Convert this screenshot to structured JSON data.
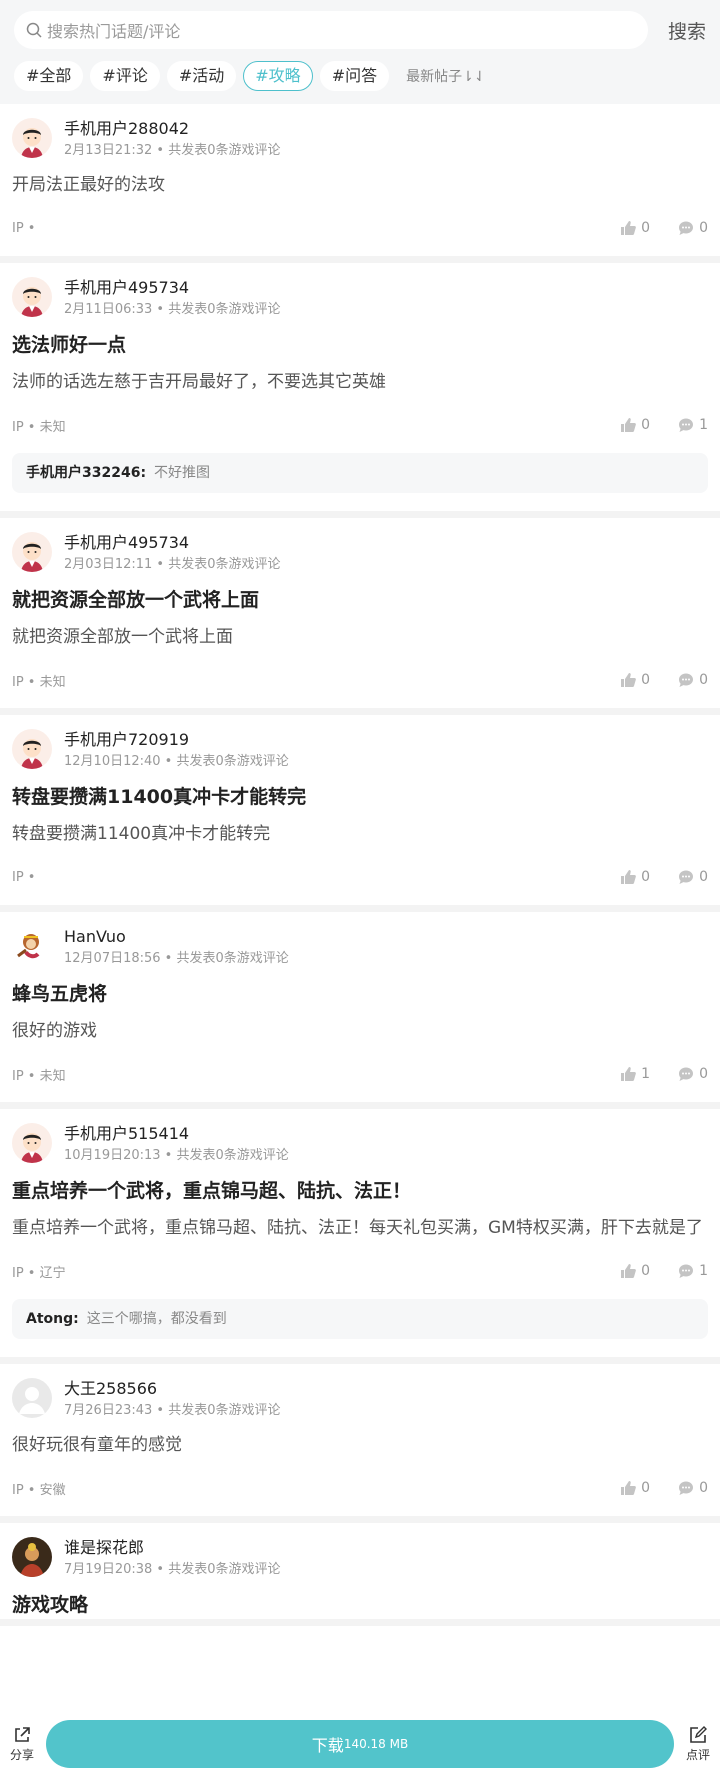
{
  "search": {
    "placeholder": "搜索热门话题/评论",
    "button": "搜索"
  },
  "tags": [
    "#全部",
    "#评论",
    "#活动",
    "#攻略",
    "#问答"
  ],
  "active_tag": "#攻略",
  "sort_label": "最新帖子⇂⇃",
  "posts": [
    {
      "user": "手机用户288042",
      "meta": "2月13日21:32 • 共发表0条游戏评论",
      "title": "",
      "body": "开局法正最好的法攻",
      "ip": "IP •",
      "likes": "0",
      "comments": "0",
      "reply": null,
      "avatar": "boy"
    },
    {
      "user": "手机用户495734",
      "meta": "2月11日06:33 • 共发表0条游戏评论",
      "title": "选法师好一点",
      "body": "法师的话选左慈于吉开局最好了，不要选其它英雄",
      "ip": "IP • 未知",
      "likes": "0",
      "comments": "1",
      "reply": {
        "user": "手机用户332246:",
        "text": "不好推图"
      },
      "avatar": "boy"
    },
    {
      "user": "手机用户495734",
      "meta": "2月03日12:11 • 共发表0条游戏评论",
      "title": "就把资源全部放一个武将上面",
      "body": "就把资源全部放一个武将上面",
      "ip": "IP • 未知",
      "likes": "0",
      "comments": "0",
      "reply": null,
      "avatar": "boy"
    },
    {
      "user": "手机用户720919",
      "meta": "12月10日12:40 • 共发表0条游戏评论",
      "title": "转盘要攒满11400真冲卡才能转完",
      "body": "转盘要攒满11400真冲卡才能转完",
      "ip": "IP •",
      "likes": "0",
      "comments": "0",
      "reply": null,
      "avatar": "boy"
    },
    {
      "user": "HanVuo",
      "meta": "12月07日18:56 • 共发表0条游戏评论",
      "title": "蜂鸟五虎将",
      "body": "很好的游戏",
      "ip": "IP • 未知",
      "likes": "1",
      "comments": "0",
      "reply": null,
      "avatar": "monkey"
    },
    {
      "user": "手机用户515414",
      "meta": "10月19日20:13 • 共发表0条游戏评论",
      "title": "重点培养一个武将，重点锦马超、陆抗、法正！",
      "body": "重点培养一个武将，重点锦马超、陆抗、法正！每天礼包买满，GM特权买满，肝下去就是了",
      "ip": "IP • 辽宁",
      "likes": "0",
      "comments": "1",
      "reply": {
        "user": "Atong:",
        "text": "这三个哪搞，都没看到"
      },
      "avatar": "boy"
    },
    {
      "user": "大王258566",
      "meta": "7月26日23:43 • 共发表0条游戏评论",
      "title": "",
      "body": "很好玩很有童年的感觉",
      "ip": "IP • 安徽",
      "likes": "0",
      "comments": "0",
      "reply": null,
      "avatar": "default"
    },
    {
      "user": "谁是探花郎",
      "meta": "7月19日20:38 • 共发表0条游戏评论",
      "title": "游戏攻略",
      "body": "",
      "ip": "",
      "likes": "",
      "comments": "",
      "reply": null,
      "avatar": "photo"
    }
  ],
  "bottom": {
    "share": "分享",
    "download": "下载",
    "size": "140.18 MB",
    "review": "点评"
  },
  "colors": {
    "accent": "#52c4cb",
    "tag_active": "#4ec0cc"
  },
  "icons": {
    "search": "search-icon",
    "like": "thumbs-up-icon",
    "comment": "comment-icon",
    "share": "share-icon",
    "review": "edit-icon"
  }
}
